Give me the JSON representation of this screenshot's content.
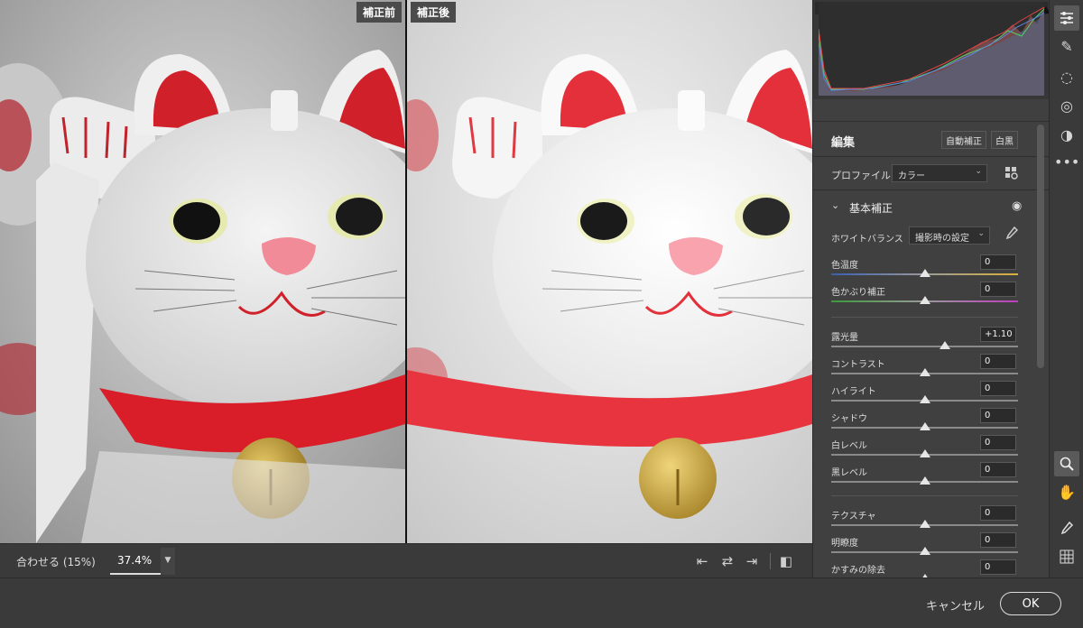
{
  "preview": {
    "before_label": "補正前",
    "after_label": "補正後"
  },
  "preview_toolbar": {
    "fit_label": "合わせる (15%)",
    "zoom_value": "37.4%"
  },
  "edit": {
    "title": "編集",
    "auto_label": "自動補正",
    "bw_label": "白黒",
    "profile_label": "プロファイル",
    "profile_value": "カラー"
  },
  "basic": {
    "title": "基本補正",
    "wb_label": "ホワイトバランス",
    "wb_value": "撮影時の設定",
    "sliders": [
      {
        "label": "色温度",
        "value": "0",
        "level": 0.5
      },
      {
        "label": "色かぶり補正",
        "value": "0",
        "level": 0.5
      },
      {
        "label": "露光量",
        "value": "+1.10",
        "level": 0.61
      },
      {
        "label": "コントラスト",
        "value": "0",
        "level": 0.5
      },
      {
        "label": "ハイライト",
        "value": "0",
        "level": 0.5
      },
      {
        "label": "シャドウ",
        "value": "0",
        "level": 0.5
      },
      {
        "label": "白レベル",
        "value": "0",
        "level": 0.5
      },
      {
        "label": "黒レベル",
        "value": "0",
        "level": 0.5
      },
      {
        "label": "テクスチャ",
        "value": "0",
        "level": 0.5
      },
      {
        "label": "明瞭度",
        "value": "0",
        "level": 0.5
      },
      {
        "label": "かすみの除去",
        "value": "0",
        "level": 0.5
      }
    ]
  },
  "footer": {
    "cancel_label": "キャンセル",
    "ok_label": "OK"
  },
  "colors": {
    "panel_bg": "#404040",
    "app_bg": "#3a3a3a",
    "cat_red": "#d91e2a",
    "bell_gold": "#c9a227"
  }
}
